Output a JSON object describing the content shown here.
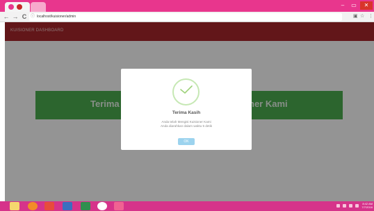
{
  "browser": {
    "address": "localhost/kuisioner/admin",
    "window_controls": {
      "minimize": "–",
      "maximize": "▭",
      "close": "✕"
    },
    "nav": {
      "back": "←",
      "forward": "→",
      "reload": "C"
    }
  },
  "app": {
    "header_title": "KUISIONER DASHBOARD",
    "banner_left": "Terima",
    "banner_right": "ner Kami"
  },
  "modal": {
    "title": "Terima Kasih",
    "message_line1": "Anda telah Mengisi Kuisioner Kami",
    "message_line2": "Anda diarahkan dalam waktu 5 detik",
    "ok_label": "OK"
  },
  "taskbar": {
    "clock_time": "8:42 AM",
    "clock_date": "7/7/2016"
  },
  "colors": {
    "header": "#a9272b",
    "banner": "#4caf50",
    "taskbar": "#d6338a",
    "ok_button": "#9cd3ee"
  }
}
